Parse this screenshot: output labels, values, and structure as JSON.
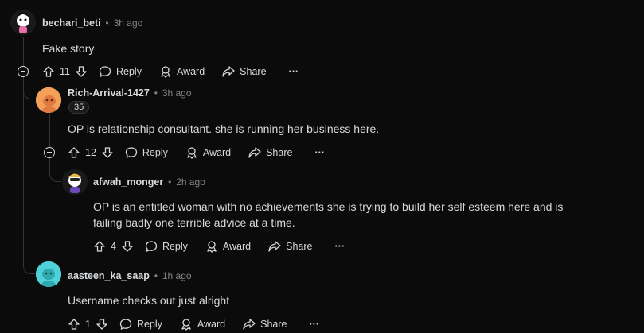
{
  "comments": [
    {
      "author": "bechari_beti",
      "time": "3h ago",
      "body": "Fake story",
      "votes": "11",
      "avatar_icon": "snoo-avatar-icon"
    },
    {
      "author": "Rich-Arrival-1427",
      "time": "3h ago",
      "flair": "35",
      "body": "OP is relationship consultant. she is running her business here.",
      "votes": "12",
      "avatar_icon": "snoo-avatar-icon"
    },
    {
      "author": "afwah_monger",
      "time": "2h ago",
      "body_line1": "OP is an entitled woman with no achievements she is trying to build her self esteem here and is",
      "body_line2": "failing badly one terrible advice at a time.",
      "votes": "4",
      "avatar_icon": "snoo-avatar-icon"
    },
    {
      "author": "aasteen_ka_saap",
      "time": "1h ago",
      "body": "Username checks out just alright",
      "votes": "1",
      "avatar_icon": "snoo-avatar-icon"
    }
  ],
  "actions": {
    "reply": "Reply",
    "award": "Award",
    "share": "Share",
    "more": "···"
  },
  "colors": {
    "background": "#0b0b0c",
    "text": "#d7dadc",
    "meta": "#818384",
    "thread_line": "#343536",
    "avatar_orange": "#f5a05a",
    "avatar_cyan": "#4fd1d9"
  }
}
